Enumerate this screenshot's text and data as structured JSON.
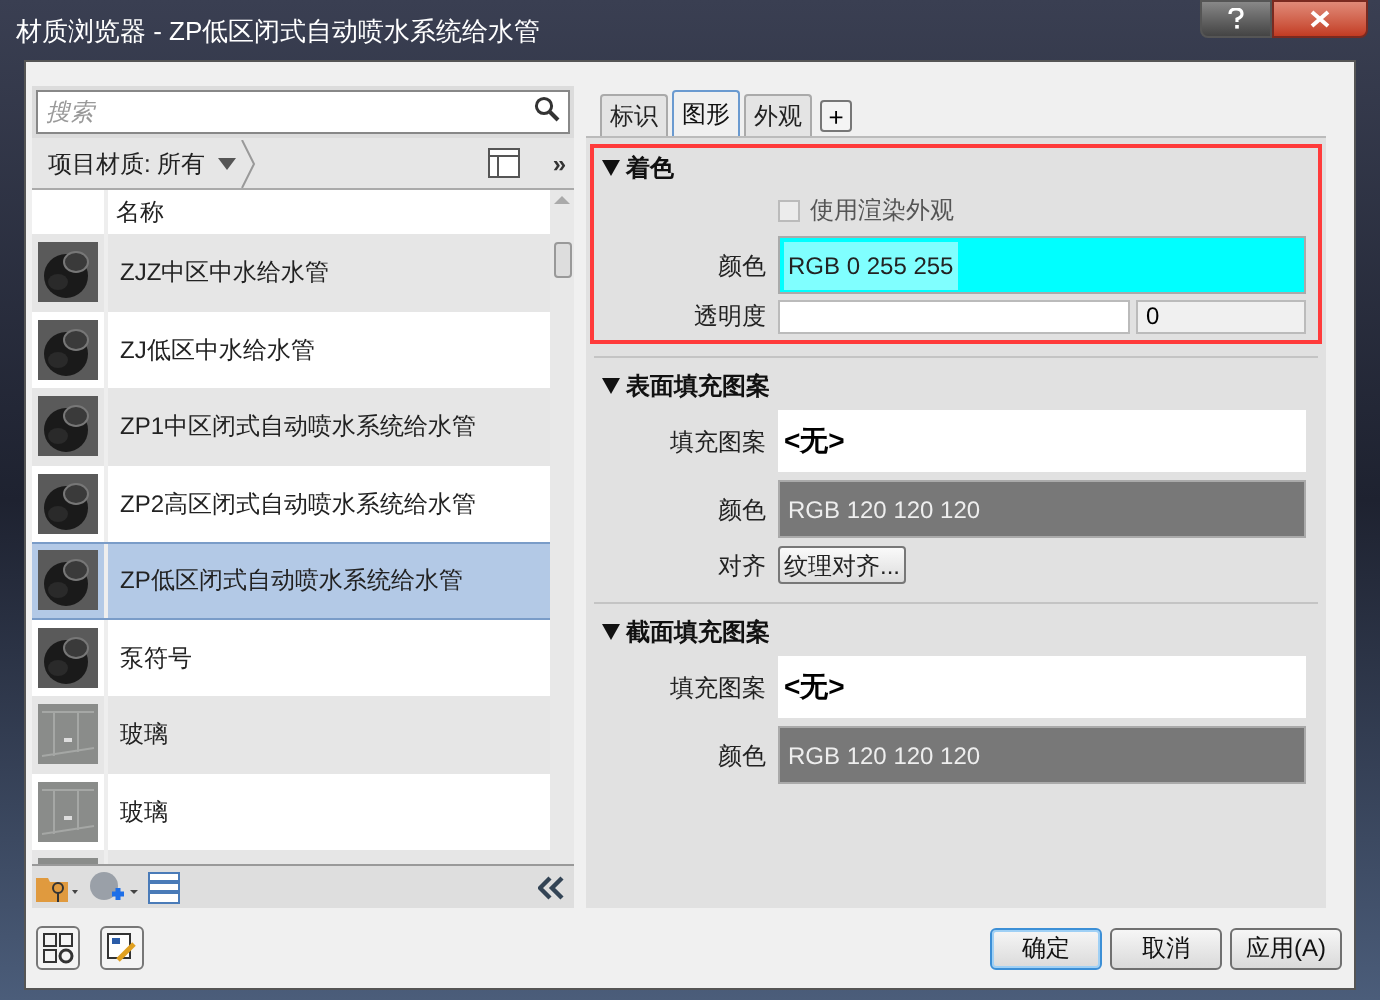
{
  "window": {
    "title": "材质浏览器 - ZP低区闭式自动喷水系统给水管"
  },
  "search": {
    "placeholder": "搜索"
  },
  "filter": {
    "label": "项目材质: 所有",
    "more": "»"
  },
  "list": {
    "column": "名称",
    "rows": [
      {
        "name": "ZJZ中区中水给水管",
        "kind": "pipe",
        "selected": false
      },
      {
        "name": "ZJ低区中水给水管",
        "kind": "pipe",
        "selected": false
      },
      {
        "name": "ZP1中区闭式自动喷水系统给水管",
        "kind": "pipe",
        "selected": false
      },
      {
        "name": "ZP2高区闭式自动喷水系统给水管",
        "kind": "pipe",
        "selected": false
      },
      {
        "name": "ZP低区闭式自动喷水系统给水管",
        "kind": "pipe",
        "selected": true
      },
      {
        "name": "泵符号",
        "kind": "pipe",
        "selected": false
      },
      {
        "name": "玻璃",
        "kind": "glass",
        "selected": false
      },
      {
        "name": "玻璃",
        "kind": "glass",
        "selected": false
      },
      {
        "kind": "glass",
        "selected": false
      }
    ]
  },
  "tabs": [
    {
      "label": "标识",
      "selected": false
    },
    {
      "label": "图形",
      "selected": true
    },
    {
      "label": "外观",
      "selected": false
    }
  ],
  "add_tab": "+",
  "sections": [
    {
      "title": "着色",
      "expanded": true,
      "highlighted": true,
      "rows": [
        {
          "kind": "checkbox",
          "label": "使用渲染外观",
          "checked": false
        },
        {
          "kind": "color",
          "label": "颜色",
          "value": "RGB 0 255 255",
          "color": "#00ffff"
        },
        {
          "kind": "slider",
          "label": "透明度",
          "value": "0"
        }
      ]
    },
    {
      "title": "表面填充图案",
      "expanded": true,
      "highlighted": false,
      "rows": [
        {
          "kind": "pattern",
          "label": "填充图案",
          "value": "<无>"
        },
        {
          "kind": "color",
          "label": "颜色",
          "value": "RGB 120 120 120",
          "color": "#787878"
        },
        {
          "kind": "button",
          "label": "对齐",
          "value": "纹理对齐..."
        }
      ]
    },
    {
      "title": "截面填充图案",
      "expanded": true,
      "highlighted": false,
      "rows": [
        {
          "kind": "pattern",
          "label": "填充图案",
          "value": "<无>"
        },
        {
          "kind": "color",
          "label": "颜色",
          "value": "RGB 120 120 120",
          "color": "#787878"
        }
      ]
    }
  ],
  "buttons": [
    {
      "label": "确定",
      "default": true
    },
    {
      "label": "取消",
      "default": false
    },
    {
      "label": "应用(A)",
      "default": false
    }
  ]
}
